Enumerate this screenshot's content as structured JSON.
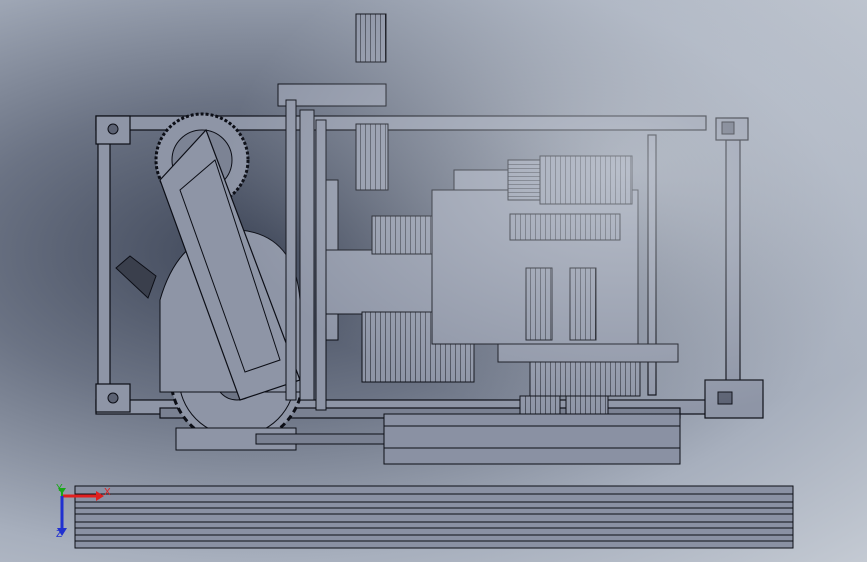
{
  "scene": {
    "background_dark": "#3e4658",
    "background_light": "#c4cad3",
    "model_fill": "#8e95a6",
    "model_fill_dark": "#5c6273",
    "model_edge": "#0c0e16"
  },
  "triad": {
    "x_label": "X",
    "y_label": "Y",
    "z_label": "Z",
    "x_color": "#e02020",
    "y_color": "#18a818",
    "z_color": "#2030d0"
  }
}
